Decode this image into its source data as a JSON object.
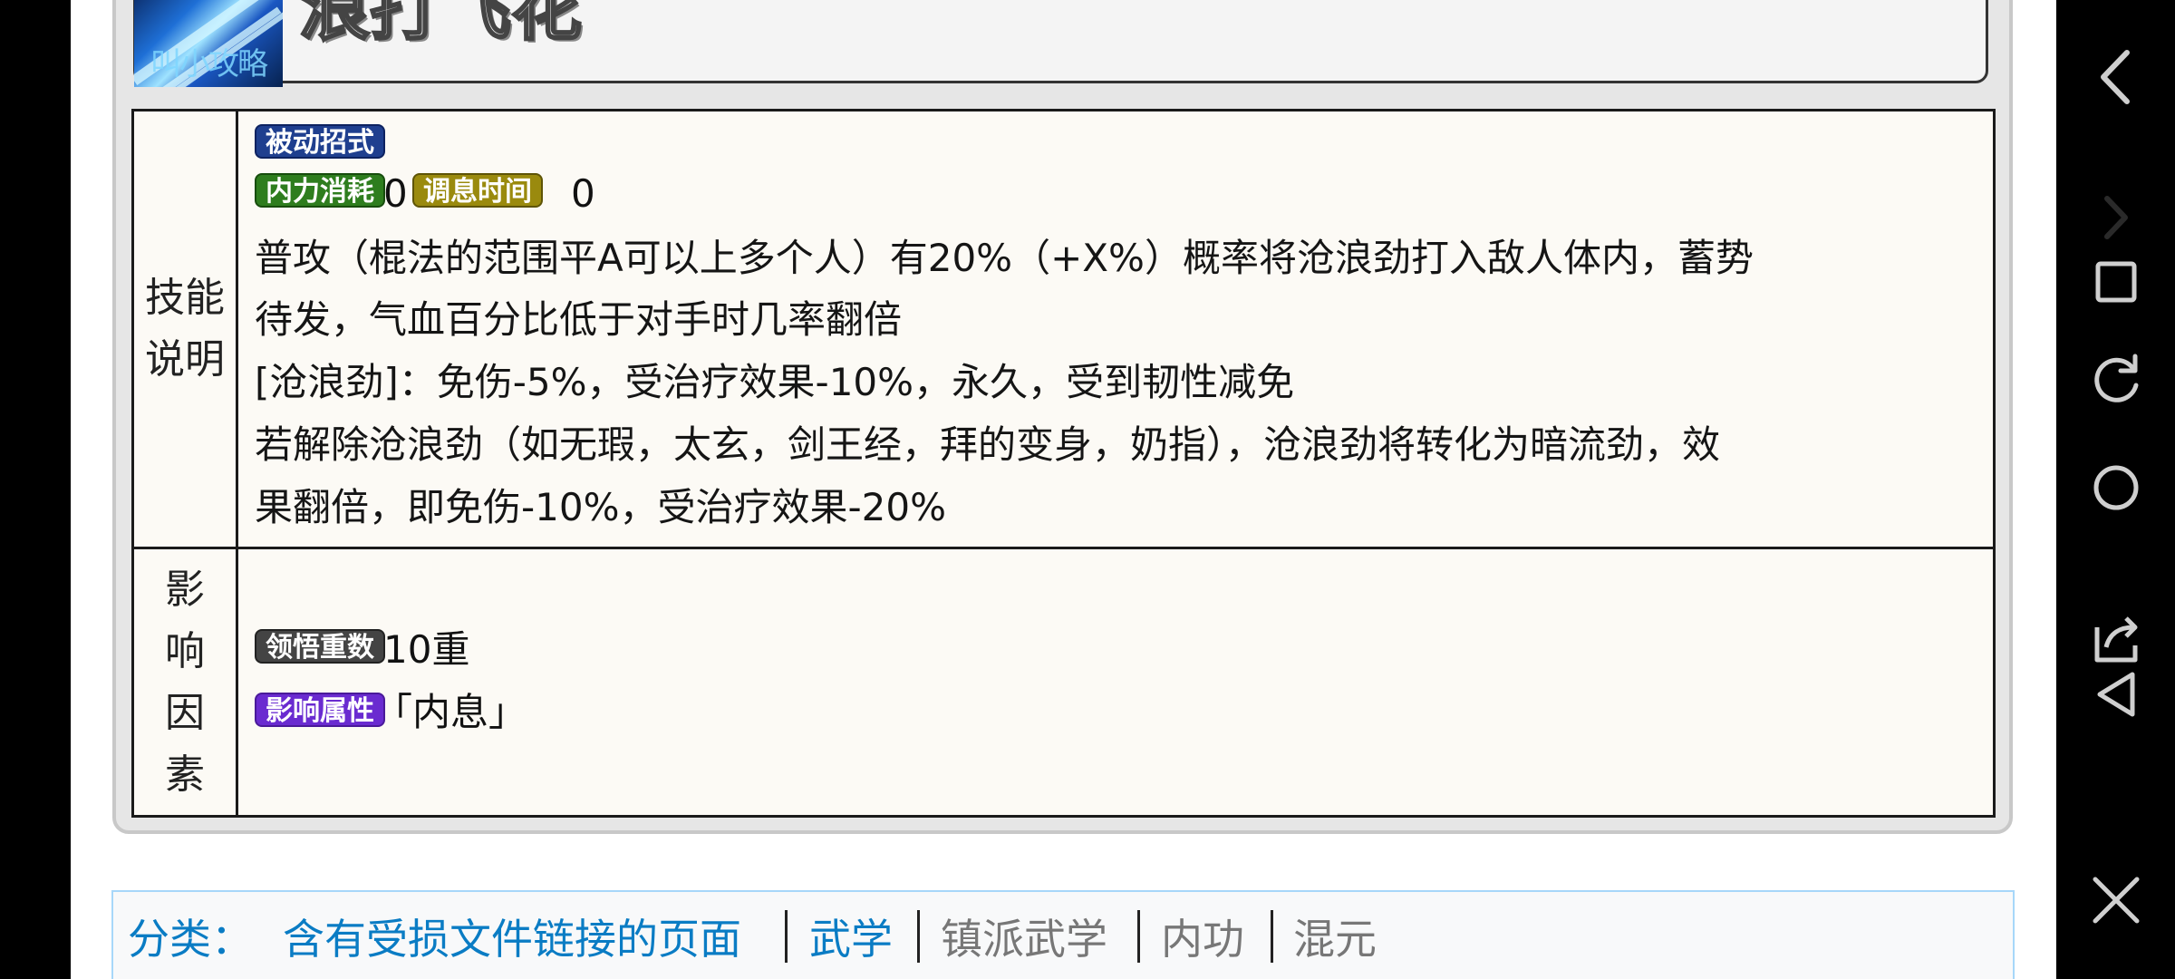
{
  "skill": {
    "name": "浪打飞花",
    "icon_caption": "叫小攻略"
  },
  "table": {
    "desc_label": "技能说明",
    "factors_label": "影响因素",
    "badges": {
      "passive": "被动招式",
      "neili": "内力消耗",
      "tiaoxi": "调息时间",
      "lingwu": "领悟重数",
      "attr": "影响属性"
    },
    "values": {
      "neili": "0",
      "tiaoxi": "0",
      "lingwu": "10重",
      "attr": "「内息」"
    },
    "description_lines": [
      "普攻（棍法的范围平A可以上多个人）有20%（+X%）概率将沧浪劲打入敌人体内，蓄势",
      "待发，气血百分比低于对手时几率翻倍",
      "[沧浪劲]：免伤-5%，受治疗效果-10%，永久，受到韧性减免",
      "若解除沧浪劲（如无瑕，太玄，剑王经，拜的变身，奶指），沧浪劲将转化为暗流劲，效",
      "果翻倍，即免伤-10%，受治疗效果-20%"
    ]
  },
  "categories": {
    "label": "分类：",
    "items": [
      "含有受损文件链接的页面",
      "武学",
      "镇派武学",
      "内功",
      "混元"
    ]
  },
  "navbar": {
    "icons": [
      "back-icon",
      "forward-icon",
      "square-icon",
      "refresh-icon",
      "home-icon",
      "share-icon",
      "triangle-back-icon",
      "close-icon"
    ]
  },
  "colors": {
    "badge_passive": "#1f3f8f",
    "badge_neili": "#2e7d1e",
    "badge_tiaoxi": "#9a8a0e",
    "badge_lingwu": "#444444",
    "badge_attr": "#6a2bd0",
    "category_link": "#0a7cc4",
    "category_muted": "#777777"
  }
}
